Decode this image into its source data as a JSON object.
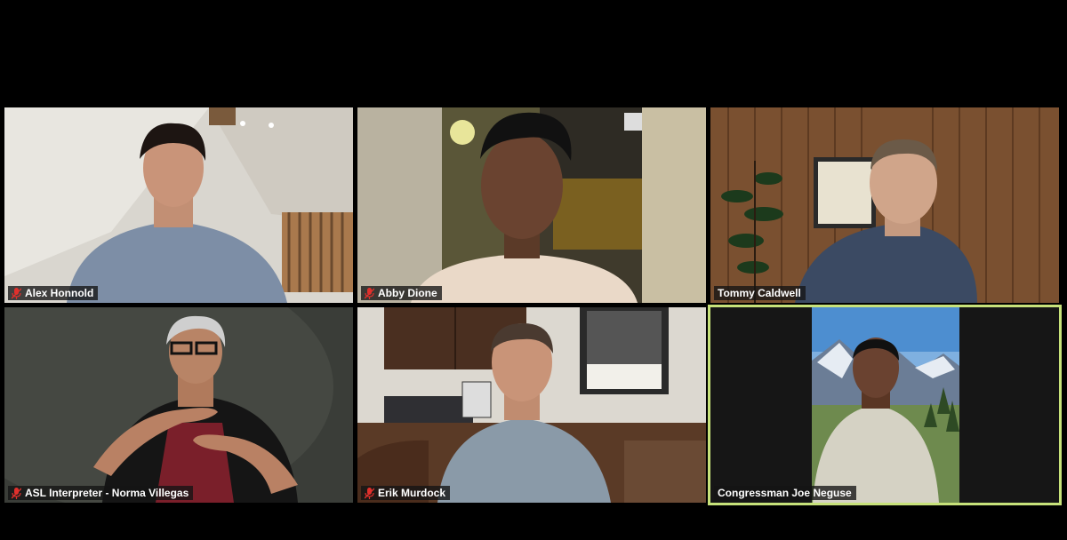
{
  "app": {
    "name": "Video conference gallery view"
  },
  "participants": [
    {
      "name": "Alex Honnold",
      "muted": true
    },
    {
      "name": "Abby Dione",
      "muted": true
    },
    {
      "name": "Tommy Caldwell",
      "muted": false
    },
    {
      "name": "ASL Interpreter - Norma Villegas",
      "muted": true
    },
    {
      "name": "Erik Murdock",
      "muted": true
    },
    {
      "name": "Congressman Joe Neguse",
      "muted": false,
      "active_speaker": true
    }
  ],
  "colors": {
    "active_speaker_border": "#c7e27a",
    "muted_icon": "#e0302c"
  },
  "icons": {
    "muted": "mic-muted-icon"
  }
}
